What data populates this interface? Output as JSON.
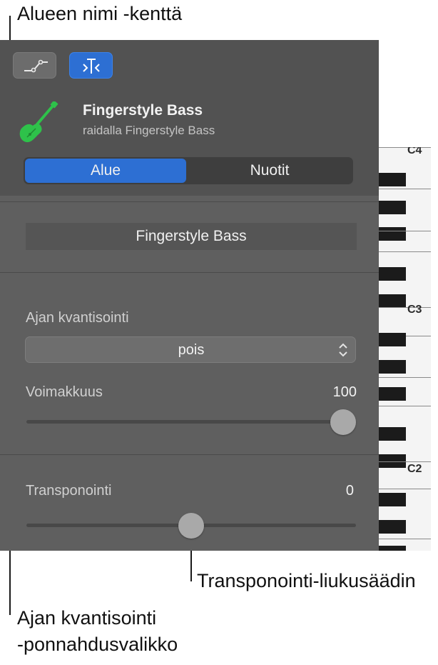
{
  "callouts": {
    "region_name": "Alueen nimi -kenttä",
    "transpose_slider": "Transponointi-liukusäädin",
    "quantize_menu_line1": "Ajan kvantisointi",
    "quantize_menu_line2": "-ponnahdusvalikko"
  },
  "track": {
    "name": "Fingerstyle Bass",
    "subtitle": "raidalla Fingerstyle Bass",
    "icon": "bass-guitar-icon"
  },
  "segmented": {
    "region_label": "Alue",
    "notes_label": "Nuotit",
    "selected": "Alue"
  },
  "region_name_value": "Fingerstyle Bass",
  "quantize": {
    "label": "Ajan kvantisointi",
    "value": "pois"
  },
  "velocity": {
    "label": "Voimakkuus",
    "value": "100",
    "level": 1.0
  },
  "transpose": {
    "label": "Transponointi",
    "value": "0",
    "level": 0.5
  },
  "keyboard": {
    "labels": [
      "C4",
      "C3",
      "C2"
    ]
  },
  "colors": {
    "accent": "#2d6fd3",
    "guitar": "#2ec24a",
    "panel": "#5f5f5f"
  }
}
